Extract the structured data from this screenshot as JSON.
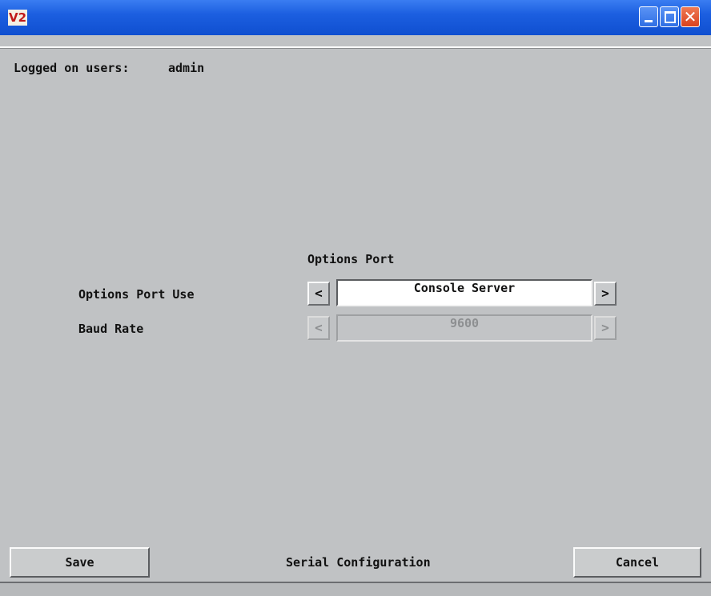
{
  "window": {
    "app_icon_text": "V2",
    "controls": {
      "minimize": "minimize",
      "maximize": "maximize",
      "close": "close"
    }
  },
  "header": {
    "users_label": "Logged on users:",
    "users_value": "admin"
  },
  "section": {
    "title": "Options Port"
  },
  "fields": [
    {
      "label": "Options Port Use",
      "value": "Console Server",
      "enabled": true
    },
    {
      "label": "Baud Rate",
      "value": "9600",
      "enabled": false
    }
  ],
  "arrows": {
    "prev": "<",
    "next": ">"
  },
  "footer": {
    "save_label": "Save",
    "title": "Serial Configuration",
    "cancel_label": "Cancel"
  },
  "colors": {
    "titlebar": "#1c5fe0",
    "background": "#c0c2c4",
    "close_button": "#d9421e"
  },
  "icons": [
    "app-logo-icon",
    "minimize-icon",
    "maximize-icon",
    "close-icon"
  ]
}
